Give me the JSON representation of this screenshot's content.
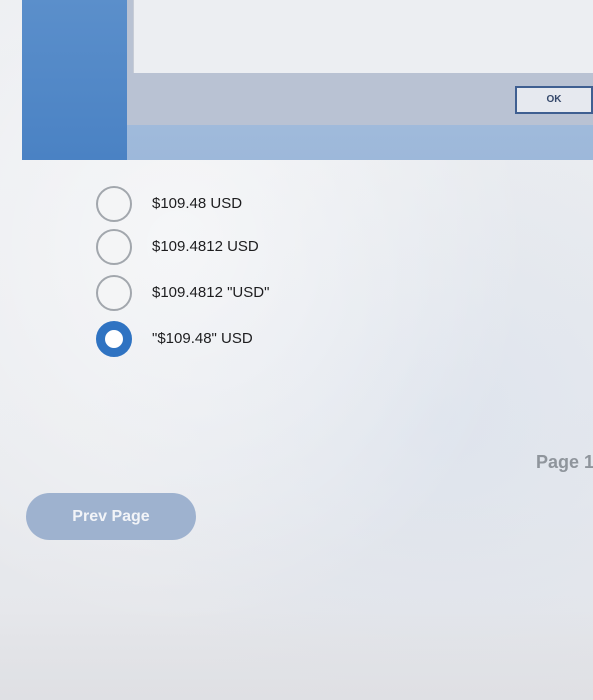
{
  "dialog": {
    "ok_label": "OK"
  },
  "question": {
    "options": [
      {
        "label": "$109.48 USD",
        "selected": false
      },
      {
        "label": "$109.4812 USD",
        "selected": false
      },
      {
        "label": "$109.4812 \"USD\"",
        "selected": false
      },
      {
        "label": "\"$109.48\" USD",
        "selected": true
      }
    ]
  },
  "footer": {
    "page_indicator": "Page 1",
    "prev_label": "Prev Page"
  },
  "colors": {
    "accent": "#2f73c2",
    "panel": "#4a82c4",
    "button": "#9eb2cf"
  }
}
